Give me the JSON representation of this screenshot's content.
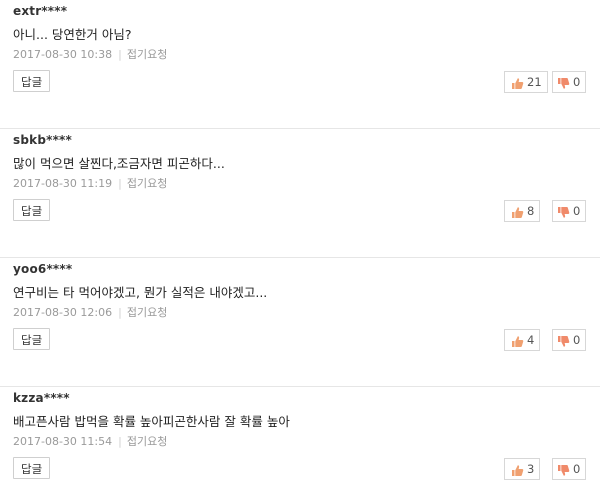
{
  "labels": {
    "reply": "답글",
    "report": "접기요청",
    "separator": "|"
  },
  "comments": [
    {
      "user": "extr****",
      "text": "아니... 당연한거 아님?",
      "datetime": "2017-08-30 10:38",
      "likes": "21",
      "dislikes": "0"
    },
    {
      "user": "sbkb****",
      "text": "많이 먹으면 살찐다,조금자면 피곤하다...",
      "datetime": "2017-08-30 11:19",
      "likes": "8",
      "dislikes": "0"
    },
    {
      "user": "yoo6****",
      "text": "연구비는 타 먹어야겠고, 뭔가 실적은 내야겠고...",
      "datetime": "2017-08-30 12:06",
      "likes": "4",
      "dislikes": "0"
    },
    {
      "user": "kzza****",
      "text": "배고픈사람 밥먹을 확률 높아피곤한사람 잘 확률 높아",
      "datetime": "2017-08-30 11:54",
      "likes": "3",
      "dislikes": "0"
    }
  ],
  "colors": {
    "like_icon": "#f0a070",
    "dislike_icon": "#f08a6a",
    "divider": "#e6e6e6"
  },
  "icons": {
    "like": "thumbs-up-icon",
    "dislike": "thumbs-down-icon"
  }
}
